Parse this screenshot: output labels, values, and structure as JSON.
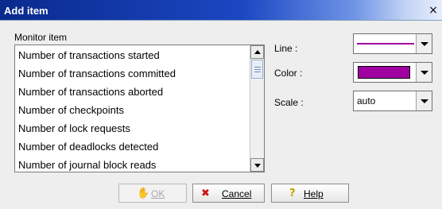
{
  "window": {
    "title": "Add item",
    "close_glyph": "×"
  },
  "monitor": {
    "label": "Monitor item",
    "items": [
      "Number of transactions started",
      "Number of transactions committed",
      "Number of transactions aborted",
      "Number of checkpoints",
      "Number of lock requests",
      "Number of deadlocks detected",
      "Number of journal block reads"
    ]
  },
  "fields": {
    "line_label": "Line :",
    "color_label": "Color :",
    "scale_label": "Scale :",
    "scale_value": "auto",
    "line_color": "#a000a0",
    "fill_color": "#a000a0"
  },
  "buttons": {
    "ok_label": "OK",
    "ok_icon": "hand-icon",
    "cancel_label": "Cancel",
    "cancel_icon": "red-x-icon",
    "help_label": "Help",
    "help_icon": "question-icon"
  }
}
